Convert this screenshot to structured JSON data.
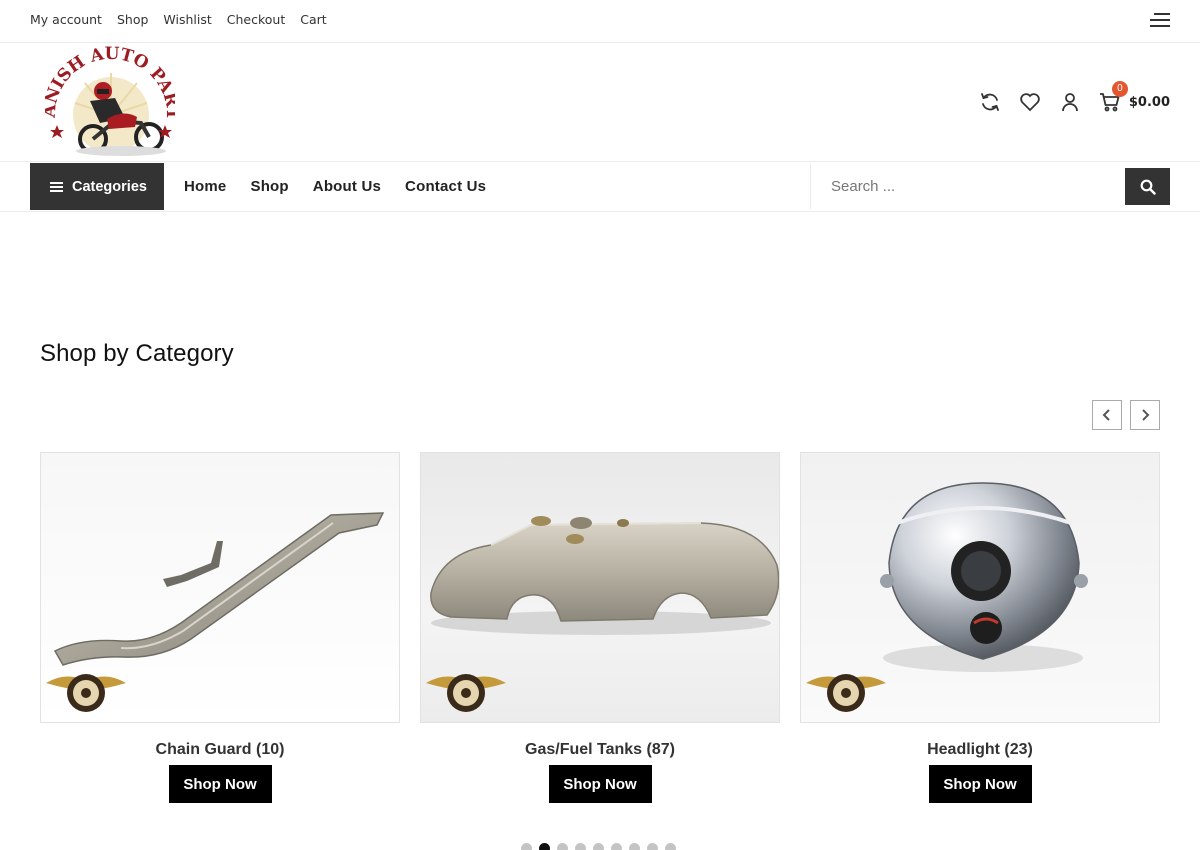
{
  "topbar": {
    "links": [
      "My account",
      "Shop",
      "Wishlist",
      "Checkout",
      "Cart"
    ]
  },
  "header": {
    "logo_text": "DANISH AUTO PARTS",
    "cart_count": "0",
    "cart_total": "$0.00"
  },
  "nav": {
    "categories_label": "Categories",
    "links": [
      "Home",
      "Shop",
      "About Us",
      "Contact Us"
    ],
    "search_placeholder": "Search ..."
  },
  "section": {
    "title": "Shop by Category",
    "cards": [
      {
        "name": "Chain Guard (10)",
        "button": "Shop Now",
        "image": "chain-guard"
      },
      {
        "name": "Gas/Fuel Tanks (87)",
        "button": "Shop Now",
        "image": "fuel-tank"
      },
      {
        "name": "Headlight (23)",
        "button": "Shop Now",
        "image": "headlight"
      }
    ],
    "carousel_dots": 9,
    "active_dot": 1
  },
  "colors": {
    "accent_dark": "#333333",
    "button_black": "#000000",
    "badge": "#e4572e"
  }
}
